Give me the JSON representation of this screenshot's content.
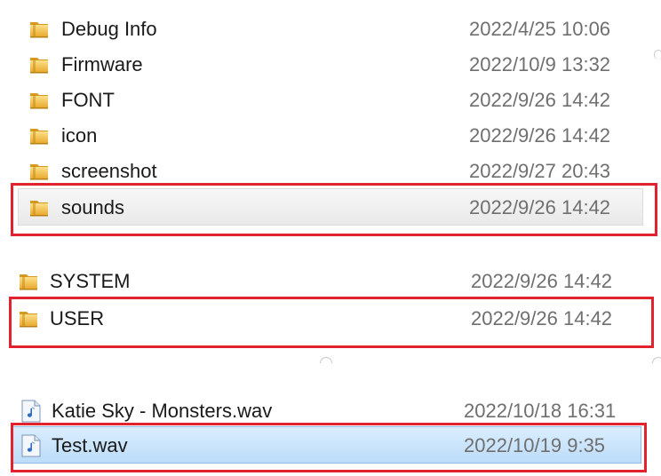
{
  "section1": {
    "files": [
      {
        "name": "Debug Info",
        "date": "2022/4/25 10:06",
        "icon": "folder-icon"
      },
      {
        "name": "Firmware",
        "date": "2022/10/9 13:32",
        "icon": "folder-icon"
      },
      {
        "name": "FONT",
        "date": "2022/9/26 14:42",
        "icon": "folder-icon"
      },
      {
        "name": "icon",
        "date": "2022/9/26 14:42",
        "icon": "folder-icon"
      },
      {
        "name": "screenshot",
        "date": "2022/9/27 20:43",
        "icon": "folder-icon"
      },
      {
        "name": "sounds",
        "date": "2022/9/26 14:42",
        "icon": "folder-icon",
        "state": "hover"
      }
    ]
  },
  "section2": {
    "files": [
      {
        "name": "SYSTEM",
        "date": "2022/9/26 14:42",
        "icon": "folder-icon"
      },
      {
        "name": "USER",
        "date": "2022/9/26 14:42",
        "icon": "folder-icon"
      }
    ]
  },
  "section3": {
    "files": [
      {
        "name": "Katie Sky - Monsters.wav",
        "date": "2022/10/18 16:31",
        "icon": "music-file-icon"
      },
      {
        "name": "Test.wav",
        "date": "2022/10/19 9:35",
        "icon": "music-file-icon",
        "state": "selected"
      }
    ]
  },
  "colors": {
    "highlight_box": "#e0232f",
    "selection": "#bcdcf8",
    "folder": "#f2c04a",
    "date_text": "#6f6f6f"
  }
}
